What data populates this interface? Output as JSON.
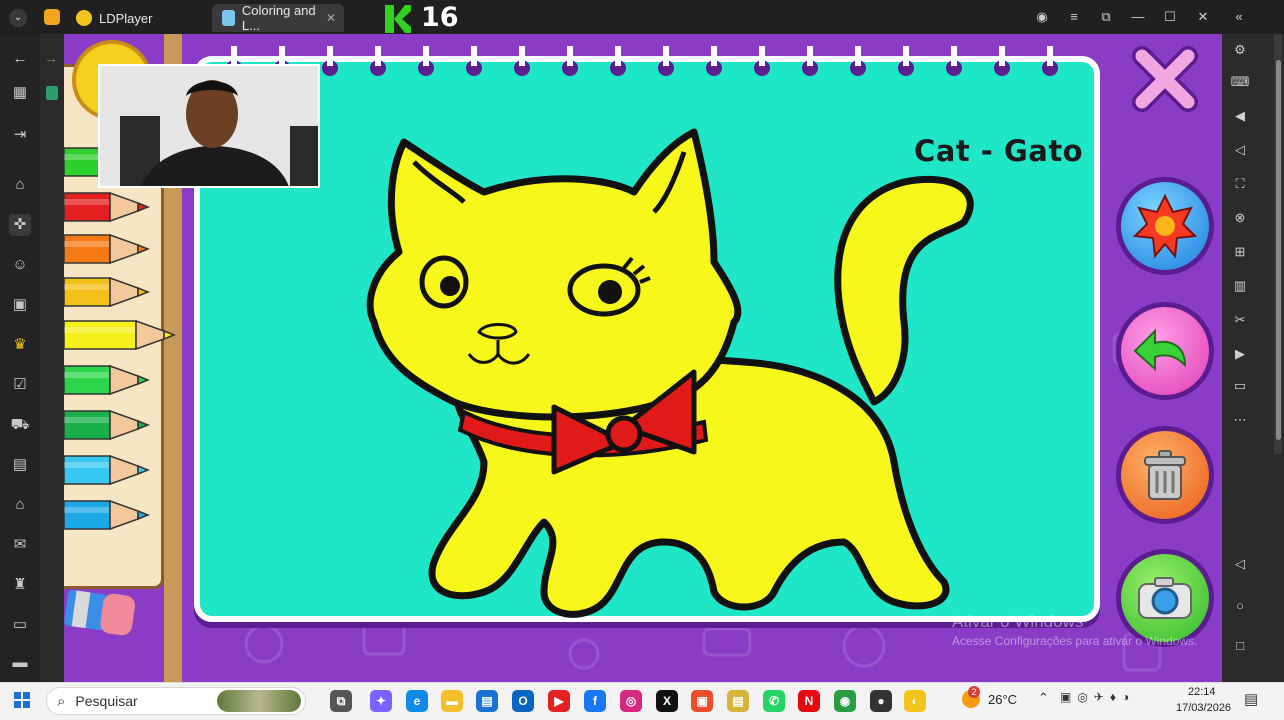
{
  "titlebar": {
    "app_tab": "LDPlayer",
    "game_tab": "Coloring and L...",
    "level_value": "16"
  },
  "game": {
    "drawing_title": "Cat - Gato",
    "pencil_colors": [
      "#2dd12d",
      "#e41f1f",
      "#f57a14",
      "#f5c01a",
      "#f5f01a",
      "#2bd64a",
      "#19b04a",
      "#37c7f0",
      "#1ba8e6"
    ],
    "background_color": "#8a3cc7",
    "canvas_color": "#20e6c8",
    "cat_color": "#f7f71c",
    "bow_color": "#e01919"
  },
  "buttons": {
    "close": "close-icon",
    "bucket": "paint-bucket-icon",
    "undo": "undo-icon",
    "trash": "trash-icon",
    "camera": "camera-icon"
  },
  "watermark": {
    "title": "Ativar o Windows",
    "subtitle": "Acesse Configurações para ativar o Windows."
  },
  "taskbar": {
    "search_placeholder": "Pesquisar",
    "temperature": "26°C",
    "weather_badge": "2",
    "time": "22:14",
    "date": "17/03/2026"
  }
}
